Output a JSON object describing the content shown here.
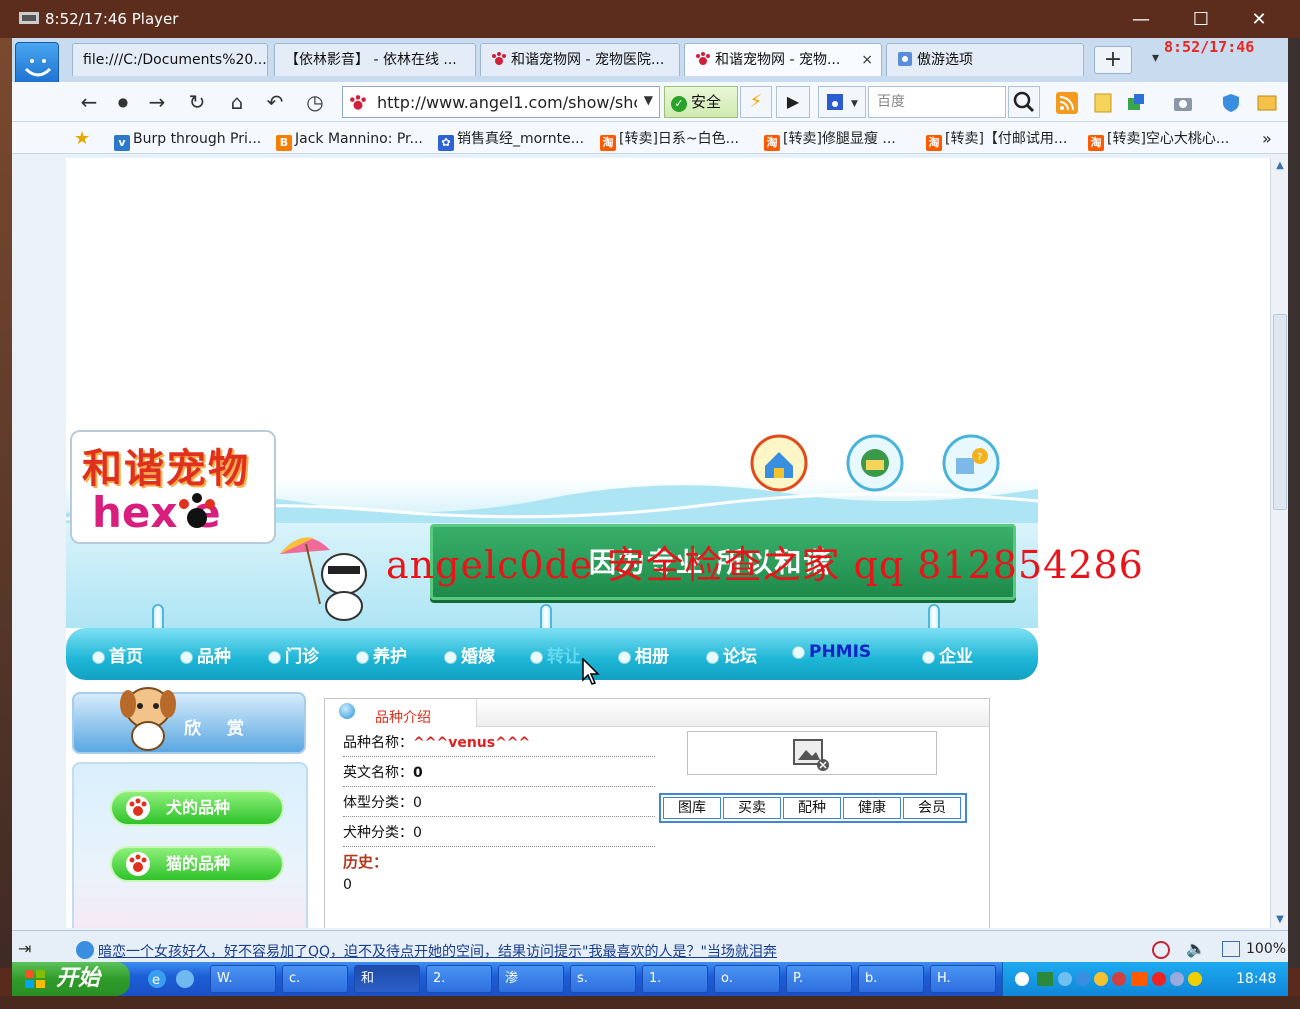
{
  "player": {
    "title": "8:52/17:46 Player"
  },
  "overlay_time": "8:52/17:46",
  "tabs": [
    {
      "label": "file:///C:/Documents%20..."
    },
    {
      "label": "【依林影音】 - 依林在线 ..."
    },
    {
      "label": "和谐宠物网 - 宠物医院..."
    },
    {
      "label": "和谐宠物网 - 宠物...",
      "close": "×"
    },
    {
      "label": "傲游选项"
    }
  ],
  "new_tab_label": "+",
  "nav": {
    "url": "http://www.angel1.com/show/shc",
    "safe_label": "安全",
    "search_placeholder": "百度"
  },
  "bookmarks": [
    {
      "label": "Burp through Pri..."
    },
    {
      "label": "Jack Mannino: Pr..."
    },
    {
      "label": "销售真经_mornte..."
    },
    {
      "label": "[转卖]日系~白色..."
    },
    {
      "label": "[转卖]修腿显瘦 ..."
    },
    {
      "label": "[转卖]【付邮试用..."
    },
    {
      "label": "[转卖]空心大桃心..."
    }
  ],
  "bookmarks_more": "»",
  "site": {
    "logo_cn": "和谐宠物",
    "logo_en": "hex e",
    "banner_text": "因为专业    所以和谐",
    "watermark": "angelc0de 安全检查之家 qq 812854286",
    "menu": [
      "首页",
      "品种",
      "门诊",
      "养护",
      "婚嫁",
      "转让",
      "相册",
      "论坛",
      "PHMIS",
      "企业"
    ],
    "sidebar_title": "欣 赏",
    "sidebar_buttons": [
      "犬的品种",
      "猫的品种"
    ],
    "panel_tab": "品种介绍",
    "fields": [
      {
        "label": "品种名称：",
        "value": "^^^venus^^^"
      },
      {
        "label": "英文名称：",
        "value": "0"
      },
      {
        "label": "体型分类：",
        "value": "0"
      },
      {
        "label": "犬种分类：",
        "value": "0"
      }
    ],
    "history_label": "历史：",
    "history_value": "0",
    "sub_buttons": [
      "图库",
      "买卖",
      "配种",
      "健康",
      "会员"
    ]
  },
  "status": {
    "ticker": "暗恋一个女孩好久，好不容易加了QQ，迫不及待点开她的空间，结果访问提示\"我最喜欢的人是？\"当场就泪奔",
    "zoom": "100%"
  },
  "taskbar": {
    "start_label": "开始",
    "tasks": [
      "W.",
      "c.",
      "和",
      "2.",
      "渗",
      "s.",
      "1.",
      "o.",
      "P.",
      "b.",
      "H."
    ],
    "clock": "18:48"
  }
}
